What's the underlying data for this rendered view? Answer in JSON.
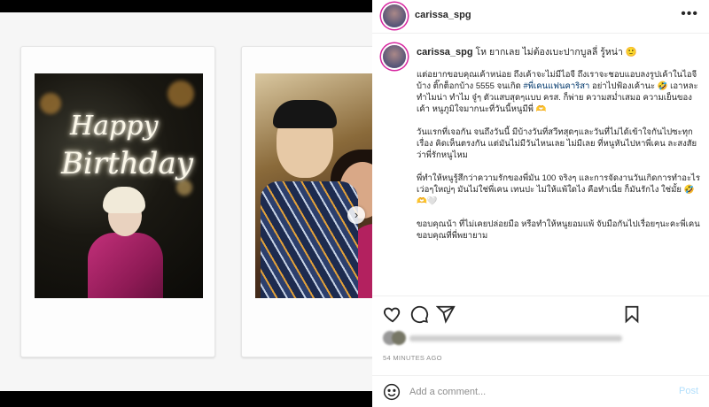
{
  "post": {
    "username": "carissa_spg",
    "more_icon": "more-horizontal-icon"
  },
  "media": {
    "neon_line1": "Happy",
    "neon_line2": "Birthday",
    "next_icon": "chevron-right-icon"
  },
  "caption": {
    "username": "carissa_spg",
    "first_line": "โห ยากเลย ไม่ต้องเบะปากบูลลี่ รู้หน่า 🙂",
    "para1_a": "แต่อยากขอบคุณเค้าหน่อย ถึงเค้าจะไม่มีไอจี ถึงเราจะชอบแอบลงรูปเค้าในไอจีบ้าง ติ๊กต็อกบ้าง 5555 จนเกิด ",
    "para1_tag": "#พี่เคนแฟนคาริสา",
    "para1_b": " อย่าไปฟ้องเค้านะ 🤣 เอาหละ ทำไมน่า ทำไม จู๋ๆ ตัวแสบสุดๆแบบ ครส. ก็พ่าย ความสม่ำเสมอ ความเย็นของเค้า หนูภูมิใจมากนะที่วันนี้หนูมีพี่ 🫶",
    "para2": "วันแรกที่เจอกัน จนถึงวันนี้ มีบ้างวันที่สวีทสุดๆและวันที่ไม่ได้เข้าใจกันไปซะทุกเรื่อง คิดเห็นตรงกัน แต่มันไม่มีวันไหนเลย ไม่มีเลย ที่หนูหันไปหาพี่เคน ละสงสัยว่าพี่รักหนูไหม",
    "para3": "พี่ทำให้หนูรู้สึกว่าความรักของพี่มัน 100 จริงๆ และการจัดงานวันเกิดการทำอะไรเว่อๆใหญ่ๆ มันไม่ใช่พี่เคน เทนปะ ไม่ให้แพ้ใดไง คือทำเนี่ย ก็มันรักไง ใช่มั้ย 🤣 🫶🤍",
    "para4": "ขอบคุณน้า ที่ไม่เคยปล่อยมือ หรือทำให้หนูยอมแพ้ จับมือกันไปเรื่อยๆนะคะพี่เคน ขอบคุณที่พี่พยายาม"
  },
  "actions": {
    "like_icon": "heart-icon",
    "comment_icon": "comment-icon",
    "share_icon": "send-icon",
    "save_icon": "bookmark-icon"
  },
  "timestamp": "54 MINUTES AGO",
  "comment": {
    "emoji_icon": "smiley-icon",
    "placeholder": "Add a comment...",
    "post_label": "Post"
  }
}
